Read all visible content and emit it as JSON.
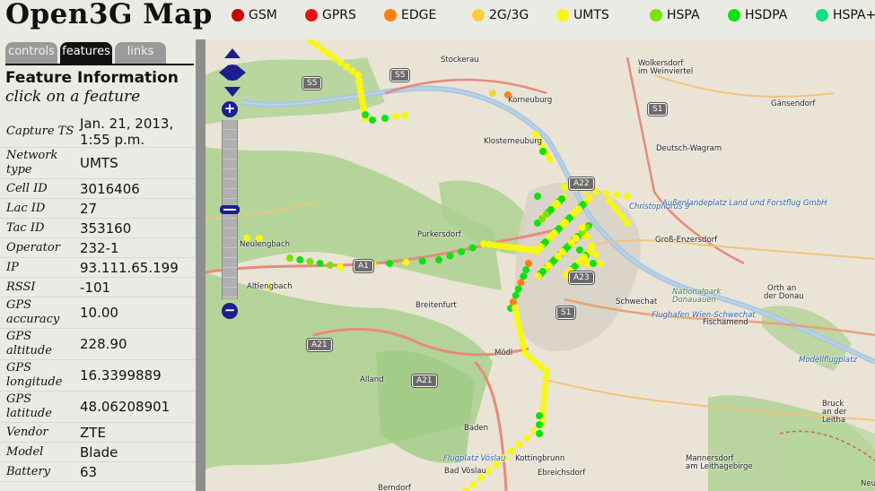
{
  "app": {
    "title": "Open3G Map"
  },
  "legend": [
    {
      "label": "GSM",
      "color": "#cc0000"
    },
    {
      "label": "GPRS",
      "color": "#ee1111"
    },
    {
      "label": "EDGE",
      "color": "#ff8011"
    },
    {
      "label": "2G/3G",
      "color": "#f7d038"
    },
    {
      "label": "UMTS",
      "color": "#f7f711"
    },
    {
      "label": "HSPA",
      "color": "#7fe000"
    },
    {
      "label": "HSDPA",
      "color": "#11e011"
    },
    {
      "label": "HSPA+",
      "color": "#11e080"
    }
  ],
  "tabs": [
    {
      "label": "controls",
      "active": false
    },
    {
      "label": "features",
      "active": true
    },
    {
      "label": "links",
      "active": false
    }
  ],
  "feature": {
    "title": "Feature Information",
    "subtitle": "click on a feature",
    "properties": [
      {
        "key": [
          "Capture TS"
        ],
        "value": [
          "Jan. 21, 2013,",
          "1:55 p.m."
        ]
      },
      {
        "key": [
          "Network",
          "type"
        ],
        "value": [
          "UMTS"
        ]
      },
      {
        "key": [
          "Cell ID"
        ],
        "value": [
          "3016406"
        ]
      },
      {
        "key": [
          "Lac ID"
        ],
        "value": [
          "27"
        ]
      },
      {
        "key": [
          "Tac ID"
        ],
        "value": [
          "353160"
        ]
      },
      {
        "key": [
          "Operator"
        ],
        "value": [
          "232-1"
        ]
      },
      {
        "key": [
          "IP"
        ],
        "value": [
          "93.111.65.199"
        ]
      },
      {
        "key": [
          "RSSI"
        ],
        "value": [
          "-101"
        ]
      },
      {
        "key": [
          "GPS",
          "accuracy"
        ],
        "value": [
          "10.00"
        ]
      },
      {
        "key": [
          "GPS",
          "altitude"
        ],
        "value": [
          "228.90"
        ]
      },
      {
        "key": [
          "GPS",
          "longitude"
        ],
        "value": [
          "16.3399889"
        ]
      },
      {
        "key": [
          "GPS",
          "latitude"
        ],
        "value": [
          "48.06208901"
        ]
      },
      {
        "key": [
          "Vendor"
        ],
        "value": [
          "ZTE"
        ]
      },
      {
        "key": [
          "Model"
        ],
        "value": [
          "Blade"
        ]
      },
      {
        "key": [
          "Battery"
        ],
        "value": [
          "63"
        ]
      }
    ]
  },
  "map": {
    "labels": [
      {
        "text": "Stockerau",
        "kind": "town"
      },
      {
        "text": "Wolkersdorf",
        "kind": "town"
      },
      {
        "text": "im Weinviertel",
        "kind": "town"
      },
      {
        "text": "Korneuburg",
        "kind": "town"
      },
      {
        "text": "Gänsendorf",
        "kind": "town"
      },
      {
        "text": "Klosterneuburg",
        "kind": "town"
      },
      {
        "text": "Deutsch-Wagram",
        "kind": "town"
      },
      {
        "text": "Christophorus 9",
        "kind": "blue"
      },
      {
        "text": "Außenlandeplatz Land und Forstflug GmbH",
        "kind": "blue"
      },
      {
        "text": "Purkersdorf",
        "kind": "town"
      },
      {
        "text": "Neulengbach",
        "kind": "town"
      },
      {
        "text": "Groß-Enzersdorf",
        "kind": "town"
      },
      {
        "text": "Altlengbach",
        "kind": "town"
      },
      {
        "text": "Orth an",
        "kind": "town"
      },
      {
        "text": "der Donau",
        "kind": "town"
      },
      {
        "text": "Breitenfurt",
        "kind": "town"
      },
      {
        "text": "Schwechat",
        "kind": "town"
      },
      {
        "text": "Nationalpark",
        "kind": "park"
      },
      {
        "text": "Donauauen",
        "kind": "park"
      },
      {
        "text": "Flughafen Wien-Schwechat",
        "kind": "blue"
      },
      {
        "text": "Fischamend",
        "kind": "town"
      },
      {
        "text": "Mödl",
        "kind": "town"
      },
      {
        "text": "Modellflugplatz",
        "kind": "blue"
      },
      {
        "text": "Alland",
        "kind": "town"
      },
      {
        "text": "Bruck",
        "kind": "town"
      },
      {
        "text": "an der",
        "kind": "town"
      },
      {
        "text": "Leitha",
        "kind": "town"
      },
      {
        "text": "Baden",
        "kind": "town"
      },
      {
        "text": "Flugplatz Vöslau",
        "kind": "blue"
      },
      {
        "text": "Kottingbrunn",
        "kind": "town"
      },
      {
        "text": "Mannersdorf",
        "kind": "town"
      },
      {
        "text": "am Leithagebirge",
        "kind": "town"
      },
      {
        "text": "Bad Vöslau",
        "kind": "town"
      },
      {
        "text": "Ebreichsdorf",
        "kind": "town"
      },
      {
        "text": "Berndorf",
        "kind": "town"
      },
      {
        "text": "Neus",
        "kind": "town"
      }
    ],
    "shields": [
      "S5",
      "S5",
      "S1",
      "A22",
      "A23",
      "A1",
      "S1",
      "A21",
      "A21"
    ],
    "zoom": {
      "in": "+",
      "out": "−"
    }
  }
}
